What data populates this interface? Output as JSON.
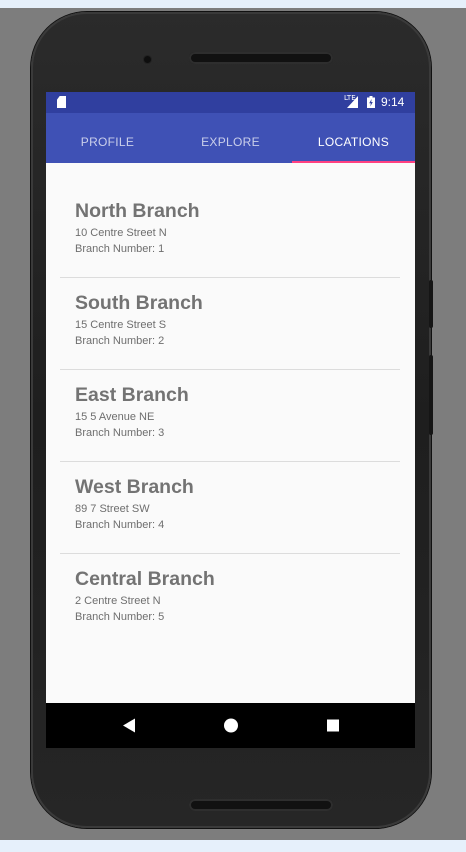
{
  "status_bar": {
    "time": "9:14",
    "network_label": "LTE",
    "icons": [
      "sd-card-icon",
      "signal-icon",
      "battery-icon"
    ]
  },
  "tabs": [
    {
      "label": "PROFILE",
      "active": false
    },
    {
      "label": "EXPLORE",
      "active": false
    },
    {
      "label": "LOCATIONS",
      "active": true
    }
  ],
  "branches": [
    {
      "name": "North Branch",
      "address": "10 Centre Street N",
      "number": "Branch Number: 1"
    },
    {
      "name": "South Branch",
      "address": "15 Centre Street S",
      "number": "Branch Number: 2"
    },
    {
      "name": "East Branch",
      "address": "15 5 Avenue NE",
      "number": "Branch Number: 3"
    },
    {
      "name": "West Branch",
      "address": "89 7 Street SW",
      "number": "Branch Number: 4"
    },
    {
      "name": "Central Branch",
      "address": "2 Centre Street N",
      "number": "Branch Number: 5"
    }
  ],
  "nav_bar": {
    "buttons": [
      "back-icon",
      "home-icon",
      "recents-icon"
    ]
  },
  "colors": {
    "status_bar": "#303f9f",
    "app_bar": "#3f51b5",
    "tab_indicator": "#ff4081",
    "screen_background": "#fafafa",
    "branch_title": "#737373"
  }
}
